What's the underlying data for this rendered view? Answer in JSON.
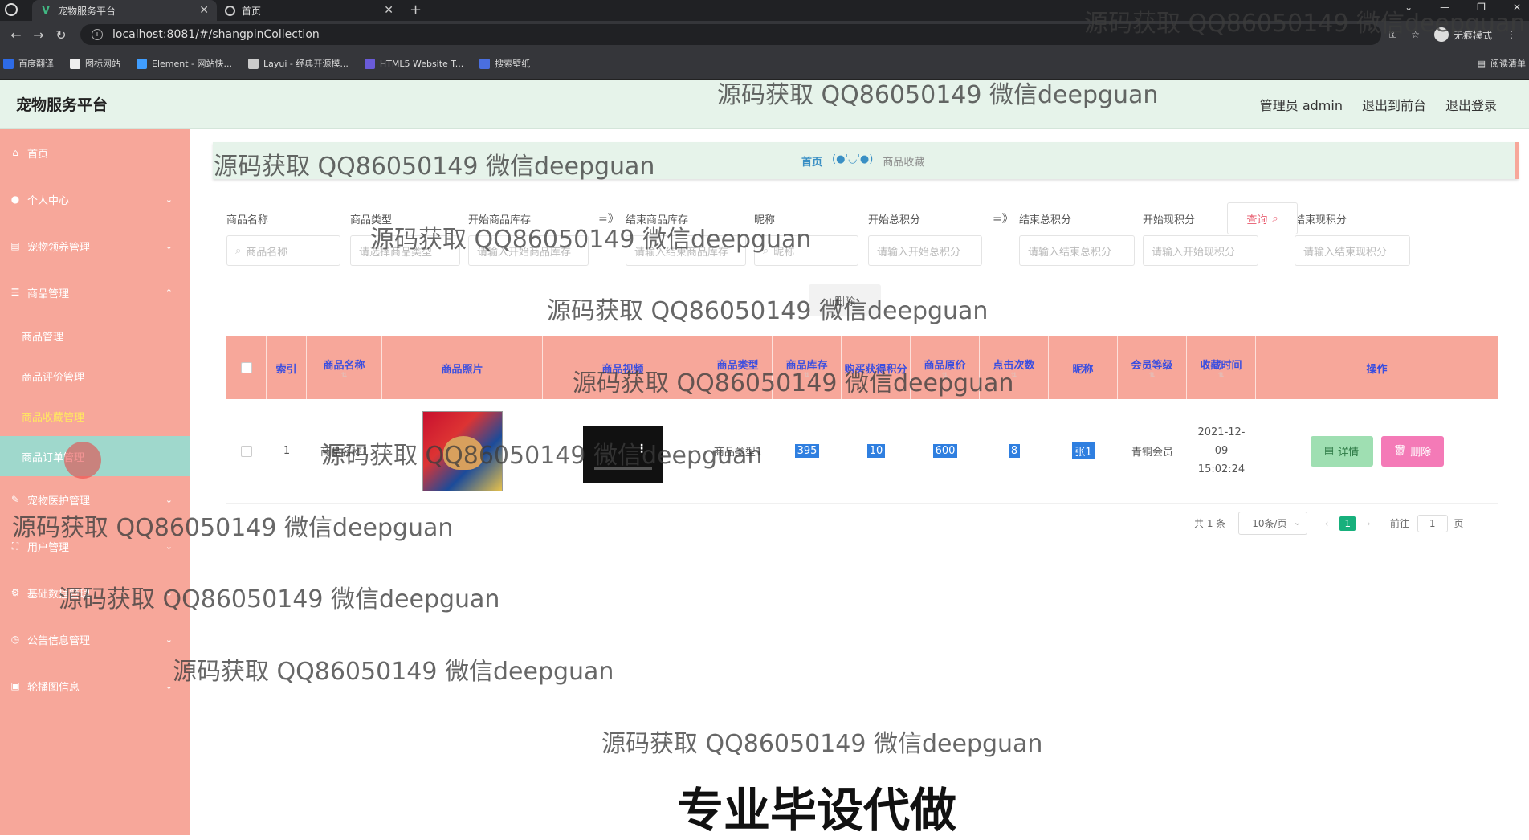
{
  "browser": {
    "tabs": [
      {
        "title": "宠物服务平台",
        "active": true
      },
      {
        "title": "首页",
        "active": false
      }
    ],
    "url": "localhost:8081/#/shangpinCollection",
    "incognito_label": "无痕模式",
    "bookmarks": [
      "百度翻译",
      "图标网站",
      "Element - 网站快...",
      "Layui - 经典开源模...",
      "HTML5 Website T...",
      "搜索壁纸"
    ],
    "reading_list": "阅读清单"
  },
  "header": {
    "brand": "宠物服务平台",
    "user": "管理员 admin",
    "to_front": "退出到前台",
    "logout": "退出登录"
  },
  "sidebar": {
    "items": [
      {
        "label": "首页",
        "icon": "home-icon"
      },
      {
        "label": "个人中心",
        "icon": "user-icon"
      },
      {
        "label": "宠物领养管理",
        "icon": "box-icon"
      },
      {
        "label": "商品管理",
        "icon": "list-icon"
      },
      {
        "label": "宠物医护管理",
        "icon": "paw-icon"
      },
      {
        "label": "用户管理",
        "icon": "users-icon"
      },
      {
        "label": "基础数据管理",
        "icon": "gear-icon"
      },
      {
        "label": "公告信息管理",
        "icon": "clock-icon"
      },
      {
        "label": "轮播图信息",
        "icon": "image-icon"
      }
    ],
    "submenu": [
      {
        "label": "商品管理"
      },
      {
        "label": "商品评价管理"
      },
      {
        "label": "商品收藏管理"
      },
      {
        "label": "商品订单管理"
      }
    ]
  },
  "breadcrumb": {
    "home": "首页",
    "sep": "(●'◡'●)",
    "current": "商品收藏"
  },
  "filters": {
    "labels": [
      "商品名称",
      "商品类型",
      "开始商品库存",
      "结束商品库存",
      "昵称",
      "开始总积分",
      "结束总积分",
      "开始现积分",
      "结束现积分"
    ],
    "placeholders": [
      "商品名称",
      "请选择商品类型",
      "请输入开始商品库存",
      "请输入结束商品库存",
      "昵称",
      "请输入开始总积分",
      "请输入结束总积分",
      "请输入开始现积分",
      "请输入结束现积分"
    ],
    "arrow": "=》",
    "query_button": "查询",
    "batch_delete": "删除"
  },
  "table": {
    "headers": [
      "索引",
      "商品名称",
      "商品照片",
      "商品视频",
      "商品类型",
      "商品库存",
      "购买获得积分",
      "商品原价",
      "点击次数",
      "昵称",
      "会员等级",
      "收藏时间",
      "操作"
    ],
    "rows": [
      {
        "index": "1",
        "name": "商品名称1",
        "type": "商品类型1",
        "stock": "395",
        "points": "10",
        "price": "600",
        "clicks": "8",
        "nickname": "张1",
        "level": "青铜会员",
        "time": "2021-12-09 15:02:24"
      }
    ],
    "detail_button": "详情",
    "delete_button": "删除"
  },
  "pager": {
    "total": "共 1 条",
    "per_page": "10条/页",
    "current_page": "1",
    "goto_label": "前往",
    "goto_value": "1",
    "page_suffix": "页"
  },
  "watermark": {
    "text": "源码获取 QQ86050149 微信deepguan",
    "big": "专业毕设代做"
  }
}
